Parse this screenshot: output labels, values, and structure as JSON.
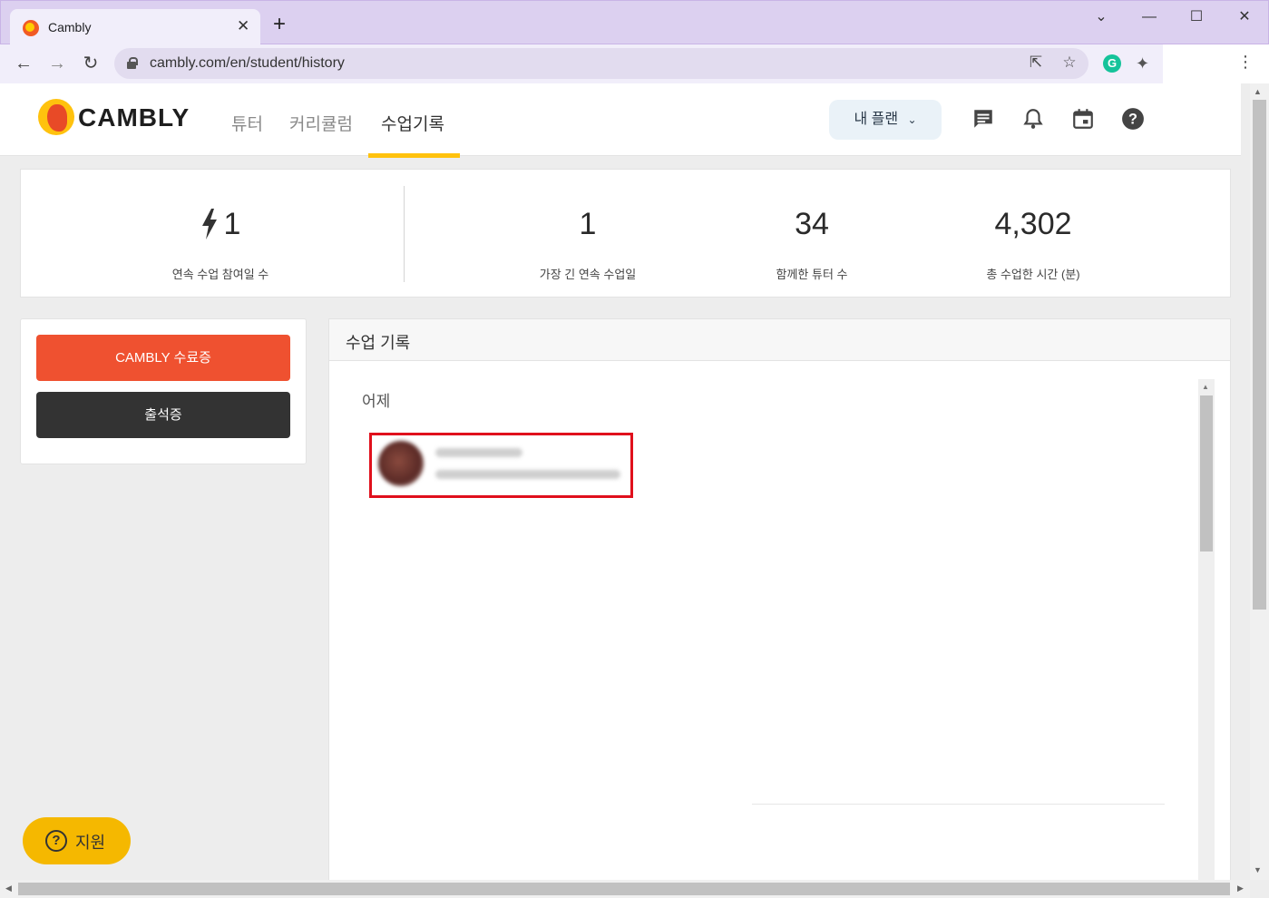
{
  "browser": {
    "tab_title": "Cambly",
    "tab_close": "✕",
    "new_tab": "+",
    "url": "cambly.com/en/student/history",
    "window_controls": {
      "minimize": "—",
      "maximize": "☐",
      "close": "✕"
    },
    "icons": [
      "back-icon",
      "forward-icon",
      "reload-icon",
      "lock-icon",
      "share-icon",
      "star-icon",
      "grammarly-icon",
      "extensions-icon",
      "menu-icon"
    ]
  },
  "header": {
    "logo": "CAMBLY",
    "nav": [
      {
        "label": "튜터"
      },
      {
        "label": "커리큘럼"
      },
      {
        "label": "수업기록"
      }
    ],
    "plan_button": "내 플랜",
    "icons": [
      "messages-icon",
      "bell-icon",
      "calendar-icon",
      "help-icon"
    ],
    "accent": "#ffc20e"
  },
  "stats": [
    {
      "value": "1",
      "label": "연속 수업 참여일 수",
      "icon": "bolt-icon"
    },
    {
      "value": "1",
      "label": "가장 긴 연속 수업일"
    },
    {
      "value": "34",
      "label": "함께한 튜터 수"
    },
    {
      "value": "4,302",
      "label": "총 수업한 시간 (분)"
    }
  ],
  "left_panel": {
    "certificate_button": "CAMBLY 수료증",
    "attendance_button": "출석증",
    "certificate_color": "#ef5130",
    "attendance_color": "#333333"
  },
  "history": {
    "title": "수업 기록",
    "day_label": "어제"
  },
  "support": {
    "icon": "?",
    "label": "지원",
    "color": "#f5b800"
  }
}
